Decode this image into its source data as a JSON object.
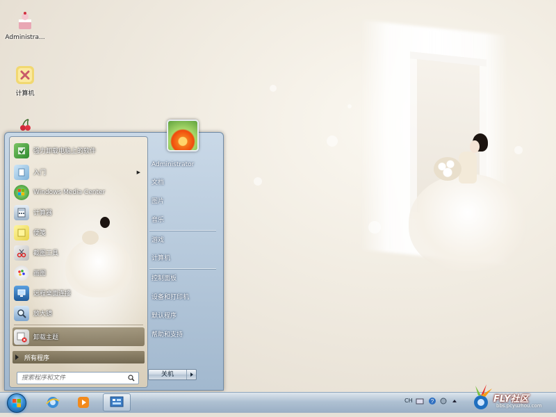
{
  "desktop": {
    "icons": [
      {
        "label": "Administra...",
        "icon": "user-cake-icon"
      },
      {
        "label": "计算机",
        "icon": "computer-icon"
      },
      {
        "label": "",
        "icon": "cherry-icon"
      }
    ]
  },
  "start_menu": {
    "programs": [
      {
        "label": "强力卸载电脑上的软件",
        "icon": "uninstall-icon"
      },
      {
        "label": "入门",
        "icon": "getting-started-icon",
        "has_submenu": true
      },
      {
        "label": "Windows Media Center",
        "icon": "media-center-icon"
      },
      {
        "label": "计算器",
        "icon": "calculator-icon"
      },
      {
        "label": "便笺",
        "icon": "sticky-notes-icon"
      },
      {
        "label": "截图工具",
        "icon": "snipping-tool-icon"
      },
      {
        "label": "画图",
        "icon": "paint-icon"
      },
      {
        "label": "远程桌面连接",
        "icon": "remote-desktop-icon"
      },
      {
        "label": "放大镜",
        "icon": "magnifier-icon"
      },
      {
        "label": "卸载主题",
        "icon": "uninstall-theme-icon",
        "highlighted": true
      }
    ],
    "all_programs_label": "所有程序",
    "search_placeholder": "搜索程序和文件",
    "right_pane": {
      "user_name": "Administrator",
      "items": [
        "文档",
        "图片",
        "音乐",
        "游戏",
        "计算机",
        "控制面板",
        "设备和打印机",
        "默认程序",
        "帮助和支持"
      ]
    },
    "shutdown_label": "关机"
  },
  "taskbar": {
    "pinned": [
      "internet-explorer-icon",
      "media-player-icon",
      "theme-app-icon"
    ],
    "tray": {
      "language": "CH"
    }
  },
  "watermark": {
    "main": "FLY社区",
    "sub": "bbs.pcyuzhou.com"
  },
  "colors": {
    "start_menu_bg": "#b3c8dd",
    "highlight": "#8a7c5f",
    "taskbar": "#aabfd4",
    "wallpaper": "#efe9df"
  }
}
